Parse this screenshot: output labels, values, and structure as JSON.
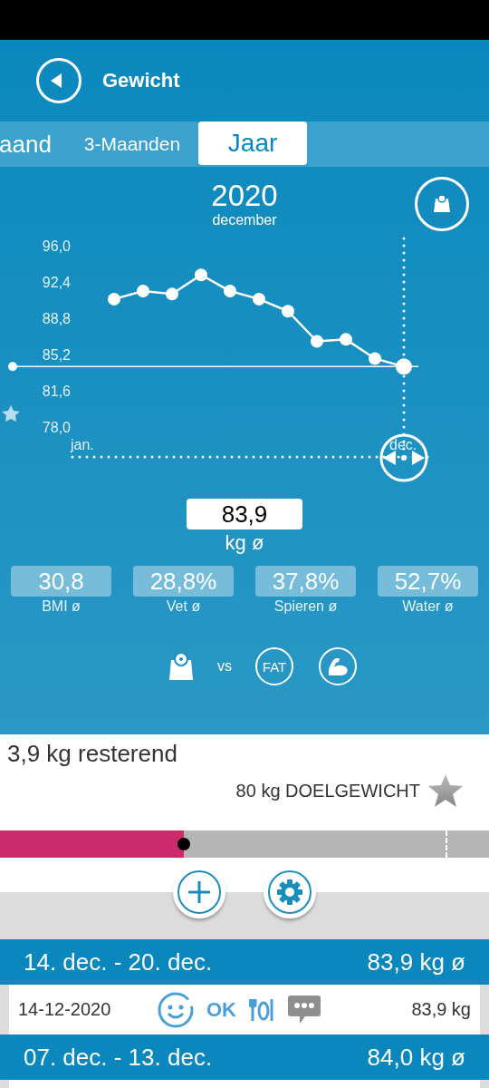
{
  "header": {
    "title": "Gewicht"
  },
  "period_tabs": [
    {
      "label": "aand",
      "selected": false
    },
    {
      "label": "3-Maanden",
      "selected": false
    },
    {
      "label": "Jaar",
      "selected": true
    }
  ],
  "period": {
    "year": "2020",
    "month": "december"
  },
  "chart": {
    "chart_data": {
      "type": "line",
      "categories": [
        "jan.",
        null,
        null,
        null,
        null,
        null,
        null,
        null,
        null,
        null,
        null,
        "dec."
      ],
      "values": [
        null,
        90.7,
        91.5,
        91.2,
        93.1,
        91.5,
        90.7,
        89.5,
        86.5,
        86.7,
        84.8,
        84.0
      ],
      "ylim": [
        78,
        96
      ],
      "marker": true,
      "yticks": [
        {
          "value": 96,
          "label": "96,0"
        },
        {
          "value": 92.4,
          "label": "92,4"
        },
        {
          "value": 88.8,
          "label": "88,8"
        },
        {
          "value": 85.2,
          "label": "85,2"
        },
        {
          "value": 81.6,
          "label": "81,6"
        },
        {
          "value": 78,
          "label": "78,0"
        }
      ]
    }
  },
  "average": {
    "value": "83,9",
    "unit": "kg ø"
  },
  "stats": [
    {
      "value": "30,8",
      "label": "BMI ø"
    },
    {
      "value": "28,8%",
      "label": "Vet ø"
    },
    {
      "value": "37,8%",
      "label": "Spieren ø"
    },
    {
      "value": "52,7%",
      "label": "Water ø"
    }
  ],
  "compare": {
    "vs": "vs",
    "fat": "FAT"
  },
  "goal": {
    "remaining": "3,9 kg resterend",
    "target": "80 kg DOELGEWICHT",
    "level": 0.376
  },
  "weeks": [
    {
      "range": "14. dec. - 20. dec.",
      "average": "83,9 kg ø",
      "entries": [
        {
          "date": "14-12-2020",
          "mood": "OK",
          "weight": "83,9 kg"
        }
      ]
    },
    {
      "range": "07. dec. - 13. dec.",
      "average": "84,0 kg ø"
    }
  ]
}
